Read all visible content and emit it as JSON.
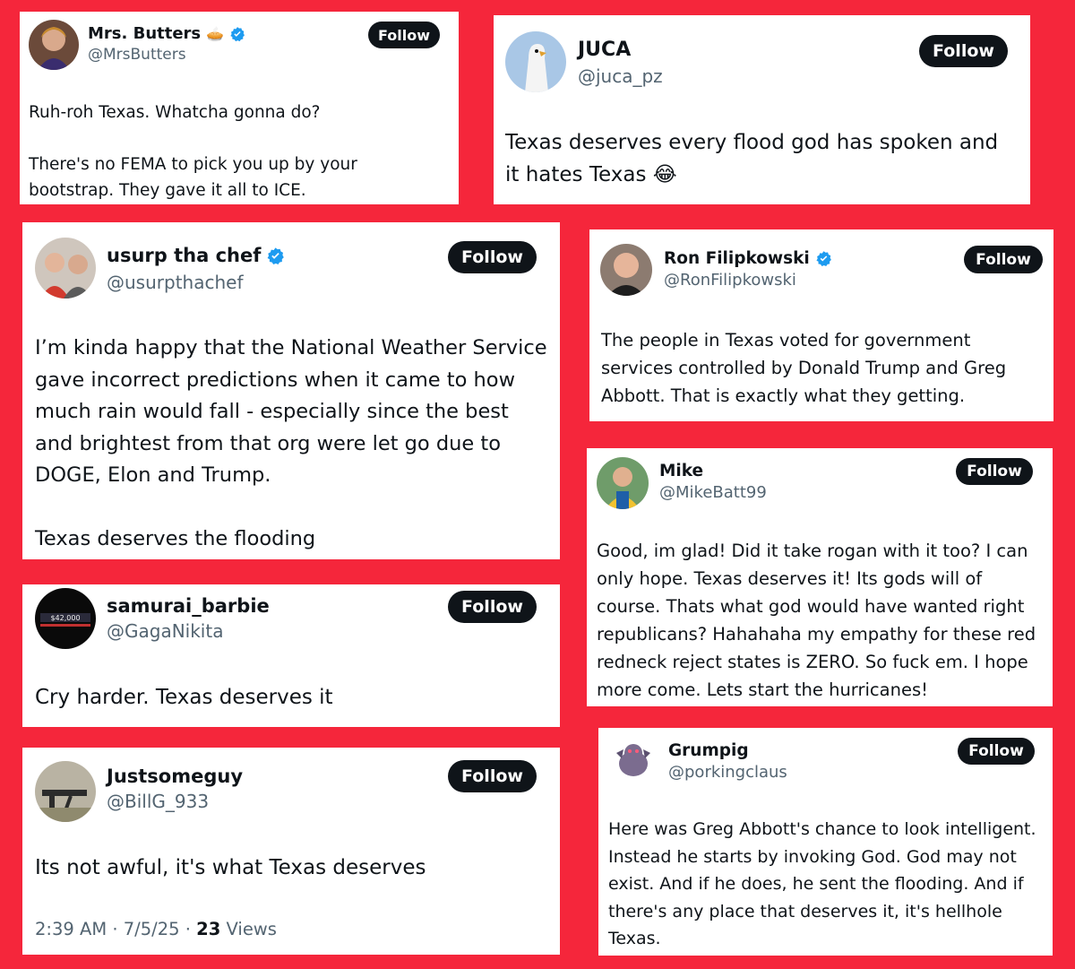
{
  "tweets": [
    {
      "name": "Mrs. Butters",
      "emoji": "🥧",
      "handle": "@MrsButters",
      "follow": "Follow",
      "text": "Ruh-roh Texas. Whatcha gonna do?\n\nThere's no FEMA to pick you up by your bootstrap. They gave it all to ICE."
    },
    {
      "name": "JUCA",
      "handle": "@juca_pz",
      "follow": "Follow",
      "text": "Texas deserves every flood god has spoken and it hates Texas 😂"
    },
    {
      "name": "usurp tha chef",
      "handle": "@usurpthachef",
      "follow": "Follow",
      "text": "I’m kinda happy that the National Weather Service gave incorrect predictions when it came to how much rain would fall - especially since the best and brightest from that org were let go due to DOGE, Elon and Trump.\n\nTexas deserves the flooding"
    },
    {
      "name": "Ron Filipkowski",
      "handle": "@RonFilipkowski",
      "follow": "Follow",
      "text": "The people in Texas voted for government services controlled by Donald Trump and Greg Abbott. That is exactly what they getting."
    },
    {
      "name": "Mike",
      "handle": "@MikeBatt99",
      "follow": "Follow",
      "text": "Good, im glad! Did it take rogan with it too? I can only hope. Texas deserves it! Its gods will of course. Thats what god would have wanted right republicans? Hahahaha my empathy for these red redneck reject states is ZERO. So fuck em. I hope more come. Lets start the hurricanes!"
    },
    {
      "name": "samurai_barbie",
      "handle": "@GagaNikita",
      "follow": "Follow",
      "avatar_text": "$42,000",
      "text": "Cry harder. Texas deserves it"
    },
    {
      "name": "Grumpig",
      "handle": "@porkingclaus",
      "follow": "Follow",
      "text": "Here was Greg Abbott's chance to look intelligent. Instead he starts by invoking God. God may not exist. And if he does, he sent the flooding. And if there's any place that deserves it, it's hellhole Texas."
    },
    {
      "name": "Justsomeguy",
      "handle": "@BillG_933",
      "follow": "Follow",
      "text": "Its not awful, it's what Texas deserves",
      "time": "2:39 AM",
      "sep": "·",
      "date": "7/5/25",
      "views_count": "23",
      "views_label": "Views"
    }
  ],
  "colors": {
    "background": "#f5263b",
    "verified": "#1d9bf0",
    "follow_button": "#0f1419",
    "handle": "#536471"
  },
  "icons": [
    "verified-badge-icon"
  ]
}
